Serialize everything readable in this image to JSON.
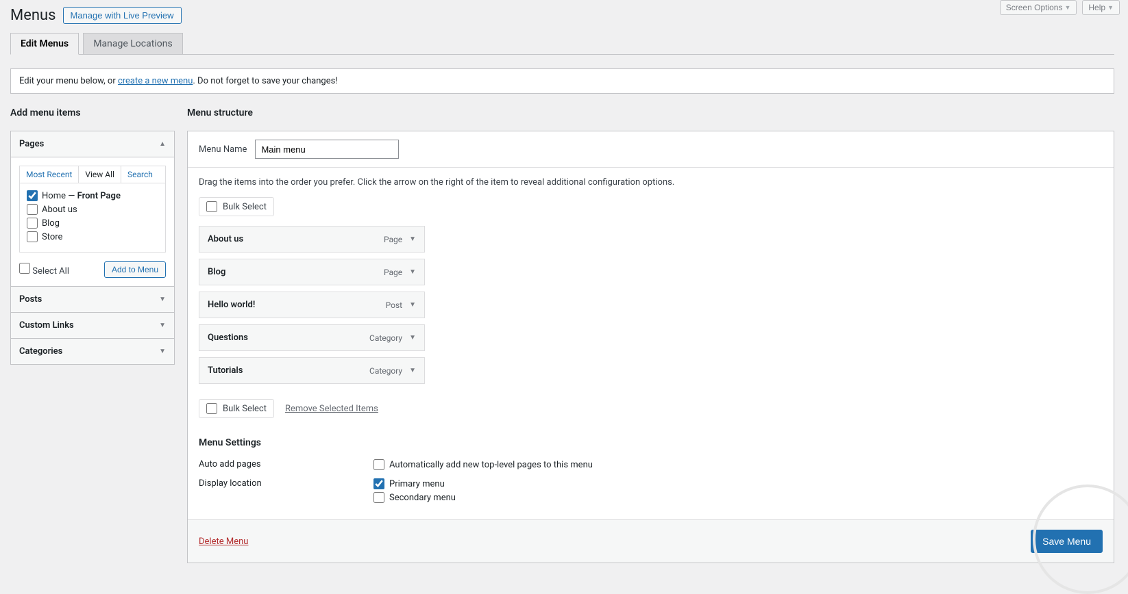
{
  "top": {
    "screen_options": "Screen Options",
    "help": "Help"
  },
  "page_title": "Menus",
  "live_preview": "Manage with Live Preview",
  "tabs": {
    "edit": "Edit Menus",
    "locations": "Manage Locations"
  },
  "notice": {
    "pre": "Edit your menu below, or ",
    "link": "create a new menu",
    "post": ". Do not forget to save your changes!"
  },
  "sidebar": {
    "heading": "Add menu items",
    "sections": {
      "pages": "Pages",
      "posts": "Posts",
      "custom_links": "Custom Links",
      "categories": "Categories"
    },
    "sub_tabs": {
      "recent": "Most Recent",
      "view_all": "View All",
      "search": "Search"
    },
    "pages_list": {
      "home_pre": "Home — ",
      "home_bold": "Front Page",
      "about": "About us",
      "blog": "Blog",
      "store": "Store"
    },
    "select_all": "Select All",
    "add_to_menu": "Add to Menu"
  },
  "structure": {
    "heading": "Menu structure",
    "menu_name_label": "Menu Name",
    "menu_name_value": "Main menu",
    "drag_text": "Drag the items into the order you prefer. Click the arrow on the right of the item to reveal additional configuration options.",
    "bulk_select": "Bulk Select",
    "items": [
      {
        "title": "About us",
        "type": "Page"
      },
      {
        "title": "Blog",
        "type": "Page"
      },
      {
        "title": "Hello world!",
        "type": "Post"
      },
      {
        "title": "Questions",
        "type": "Category"
      },
      {
        "title": "Tutorials",
        "type": "Category"
      }
    ],
    "remove_selected": "Remove Selected Items"
  },
  "settings": {
    "heading": "Menu Settings",
    "auto_add_label": "Auto add pages",
    "auto_add_option": "Automatically add new top-level pages to this menu",
    "display_label": "Display location",
    "primary": "Primary menu",
    "secondary": "Secondary menu"
  },
  "footer": {
    "delete": "Delete Menu",
    "save": "Save Menu"
  }
}
